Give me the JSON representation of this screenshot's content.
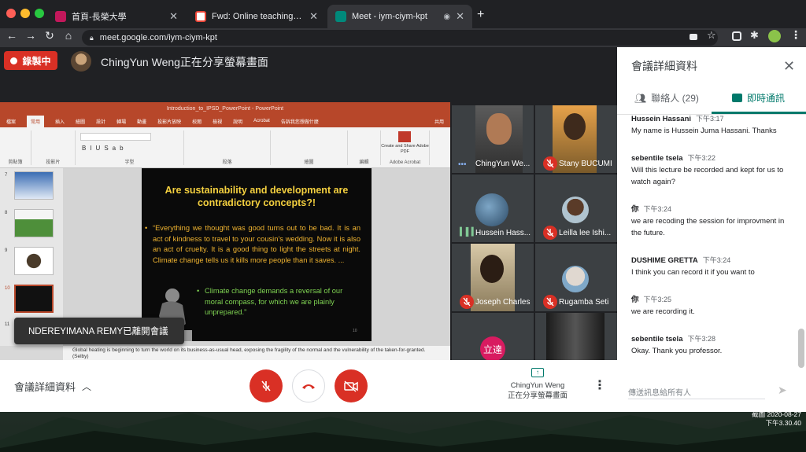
{
  "browser": {
    "tabs": [
      {
        "title": "首頁-長榮大學",
        "favicon_color": "#c2185b"
      },
      {
        "title": "Fwd: Online teaching test - ch",
        "favicon_color": "#ea4335"
      },
      {
        "title": "Meet - iym-ciym-kpt",
        "favicon_color": "#00897b"
      }
    ],
    "url": "meet.google.com/iym-ciym-kpt"
  },
  "meet": {
    "recording_label": "錄製中",
    "presenter_text": "ChingYun Weng正在分享螢幕畫面",
    "toast": "NDEREYIMANA REMY已離開會議",
    "details_label": "會議詳細資料",
    "present_name": "ChingYun Weng",
    "present_sub": "正在分享螢幕畫面"
  },
  "ppt": {
    "window_title": "Introduction_to_IPSD_PowerPoint - PowerPoint",
    "menu": [
      "檔案",
      "常用",
      "插入",
      "繪圖",
      "設計",
      "轉場",
      "動畫",
      "投影片放映",
      "校閱",
      "檢視",
      "說明",
      "Acrobat",
      "告訴我您想做什麼"
    ],
    "share_label": "共用",
    "ribbon_groups": [
      "剪貼簿",
      "投影片",
      "字型",
      "段落",
      "繪圖",
      "編輯",
      "Adobe Acrobat"
    ],
    "acrobat_btn": "Create and Share Adobe PDF",
    "thumb_numbers": [
      "7",
      "8",
      "9",
      "10",
      "11"
    ],
    "slide_title": "Are sustainability and development are contradictory concepts?!",
    "bullet1": "“Everything we thought was good turns out to be bad. It is an act of kindness to travel to your cousin’s wedding. Now it is also an act of cruelty. It is a good thing to light the streets at night. Climate change tells us it kills more people than it saves. ...",
    "bullet2": "Climate change demands a reversal of our moral compass, for which we are plainly unprepared.”",
    "slide_number": "10",
    "notes": "Global heating is beginning to turn the world on its business-as-usual head, exposing the fragility of the normal and the vulnerability of the taken-for-granted. (Selby)"
  },
  "participants": [
    {
      "name": "ChingYun We...",
      "muted": false
    },
    {
      "name": "Stany BUCUMI",
      "muted": true
    },
    {
      "name": "Hussein Hass...",
      "muted": false
    },
    {
      "name": "Leilla lee Ishi...",
      "muted": true
    },
    {
      "name": "Joseph Charles",
      "muted": true
    },
    {
      "name": "Rugamba Seti",
      "muted": true
    },
    {
      "name": "立達",
      "muted": false
    },
    {
      "name": "",
      "muted": false
    }
  ],
  "panel": {
    "title": "會議詳細資料",
    "tab_people": "聯絡人 (29)",
    "tab_chat": "即時通訊",
    "messages": [
      {
        "who": "Hussein Hassani",
        "time": "下午3:17",
        "text": "My name is Hussein Juma Hassani. Thanks"
      },
      {
        "who": "sebentile tsela",
        "time": "下午3:22",
        "text": "Will this lecture be recorded and kept for us to watch again?"
      },
      {
        "who": "你",
        "time": "下午3:24",
        "text": "we are recoding the session for improvment in the future."
      },
      {
        "who": "DUSHIME GRETTA",
        "time": "下午3:24",
        "text": "I think you can record it if you want to"
      },
      {
        "who": "你",
        "time": "下午3:25",
        "text": "we are recording it."
      },
      {
        "who": "sebentile tsela",
        "time": "下午3:28",
        "text": "Okay. Thank you professor."
      }
    ],
    "input_placeholder": "傳送訊息給所有人"
  },
  "desktop": {
    "stamp_line1": "截圖 2020-08-27",
    "stamp_line2": "下午3.30.40"
  },
  "colors": {
    "accent": "#00796b",
    "danger": "#d93025",
    "ppt": "#b7472a"
  }
}
